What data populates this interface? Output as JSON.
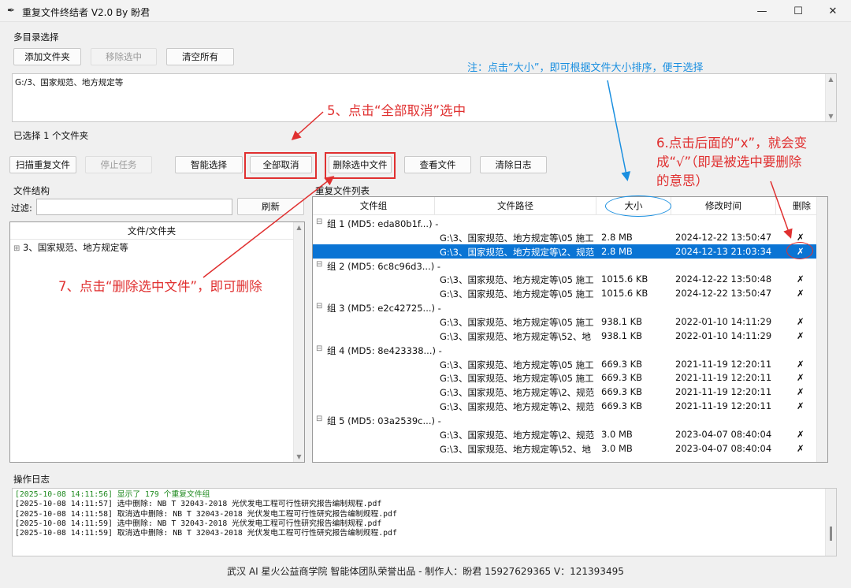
{
  "window": {
    "title": "重复文件终结者 V2.0 By 盼君",
    "minimize": "—",
    "maximize": "☐",
    "close": "✕"
  },
  "multi_dir": {
    "section_label": "多目录选择",
    "add_folder": "添加文件夹",
    "remove_selected": "移除选中",
    "clear_all": "清空所有",
    "dir_list": [
      "G:/3、国家规范、地方规定等"
    ],
    "selected_count": "已选择 1 个文件夹"
  },
  "actions": {
    "scan": "扫描重复文件",
    "stop": "停止任务",
    "smart_select": "智能选择",
    "deselect_all": "全部取消",
    "delete_selected": "删除选中文件",
    "view_file": "查看文件",
    "clear_log": "清除日志"
  },
  "file_structure": {
    "section_label": "文件结构",
    "filter_label": "过滤:",
    "filter_value": "",
    "refresh": "刷新",
    "column_header": "文件/文件夹",
    "tree_items": [
      {
        "expander": "⊞",
        "label": "3、国家规范、地方规定等"
      }
    ]
  },
  "results": {
    "section_label": "重复文件列表",
    "headers": {
      "group": "文件组",
      "path": "文件路径",
      "size": "大小",
      "mtime": "修改时间",
      "delete": "删除"
    },
    "rows": [
      {
        "type": "group",
        "label": "组 1 (MD5: eda80b1f...) -"
      },
      {
        "type": "file",
        "path": "G:\\3、国家规范、地方规定等\\05 施工",
        "size": "2.8 MB",
        "mtime": "2024-12-22 13:50:47",
        "mark": "✗"
      },
      {
        "type": "file",
        "path": "G:\\3、国家规范、地方规定等\\2、规范",
        "size": "2.8 MB",
        "mtime": "2024-12-13 21:03:34",
        "mark": "✗",
        "selected": true
      },
      {
        "type": "group",
        "label": "组 2 (MD5: 6c8c96d3...) -"
      },
      {
        "type": "file",
        "path": "G:\\3、国家规范、地方规定等\\05 施工",
        "size": "1015.6 KB",
        "mtime": "2024-12-22 13:50:48",
        "mark": "✗"
      },
      {
        "type": "file",
        "path": "G:\\3、国家规范、地方规定等\\05 施工",
        "size": "1015.6 KB",
        "mtime": "2024-12-22 13:50:47",
        "mark": "✗"
      },
      {
        "type": "group",
        "label": "组 3 (MD5: e2c42725...) -"
      },
      {
        "type": "file",
        "path": "G:\\3、国家规范、地方规定等\\05 施工",
        "size": "938.1 KB",
        "mtime": "2022-01-10 14:11:29",
        "mark": "✗"
      },
      {
        "type": "file",
        "path": "G:\\3、国家规范、地方规定等\\52、地",
        "size": "938.1 KB",
        "mtime": "2022-01-10 14:11:29",
        "mark": "✗"
      },
      {
        "type": "group",
        "label": "组 4 (MD5: 8e423338...) -"
      },
      {
        "type": "file",
        "path": "G:\\3、国家规范、地方规定等\\05 施工",
        "size": "669.3 KB",
        "mtime": "2021-11-19 12:20:11",
        "mark": "✗"
      },
      {
        "type": "file",
        "path": "G:\\3、国家规范、地方规定等\\05 施工",
        "size": "669.3 KB",
        "mtime": "2021-11-19 12:20:11",
        "mark": "✗"
      },
      {
        "type": "file",
        "path": "G:\\3、国家规范、地方规定等\\2、规范",
        "size": "669.3 KB",
        "mtime": "2021-11-19 12:20:11",
        "mark": "✗"
      },
      {
        "type": "file",
        "path": "G:\\3、国家规范、地方规定等\\2、规范",
        "size": "669.3 KB",
        "mtime": "2021-11-19 12:20:11",
        "mark": "✗"
      },
      {
        "type": "group",
        "label": "组 5 (MD5: 03a2539c...) -"
      },
      {
        "type": "file",
        "path": "G:\\3、国家规范、地方规定等\\2、规范",
        "size": "3.0 MB",
        "mtime": "2023-04-07 08:40:04",
        "mark": "✗"
      },
      {
        "type": "file",
        "path": "G:\\3、国家规范、地方规定等\\52、地",
        "size": "3.0 MB",
        "mtime": "2023-04-07 08:40:04",
        "mark": "✗"
      }
    ]
  },
  "log": {
    "section_label": "操作日志",
    "lines": [
      {
        "text": "[2025-10-08 14:11:56] 显示了 179 个重复文件组",
        "color": "#1f8a1f"
      },
      {
        "text": "[2025-10-08 14:11:57] 选中删除: NB T 32043-2018 光伏发电工程可行性研究报告编制规程.pdf",
        "color": "#111111"
      },
      {
        "text": "[2025-10-08 14:11:58] 取消选中删除: NB T 32043-2018 光伏发电工程可行性研究报告编制规程.pdf",
        "color": "#111111"
      },
      {
        "text": "[2025-10-08 14:11:59] 选中删除: NB T 32043-2018 光伏发电工程可行性研究报告编制规程.pdf",
        "color": "#111111"
      },
      {
        "text": "[2025-10-08 14:11:59] 取消选中删除: NB T 32043-2018 光伏发电工程可行性研究报告编制规程.pdf",
        "color": "#111111"
      }
    ]
  },
  "footer": "武汉 AI 星火公益商学院 智能体团队荣誉出品 - 制作人：盼君 15927629365 V：121393495",
  "annotations": {
    "note_size": "注：点击“大小”，即可根据文件大小排序，便于选择",
    "step5": "5、点击“全部取消”选中",
    "step6": "6.点击后面的“x”，就会变成“√”（即是被选中要删除的意思）",
    "step6_lines": [
      "6.点击后面的“x”，就会变",
      "成“√”（即是被选中要删除",
      "的意思）"
    ],
    "step7": "7、点击“删除选中文件”，即可删除"
  },
  "colors": {
    "accent": "#0a74d4",
    "annotation_red": "#e03030",
    "annotation_blue": "#1a8fe0",
    "log_green": "#1f8a1f"
  }
}
